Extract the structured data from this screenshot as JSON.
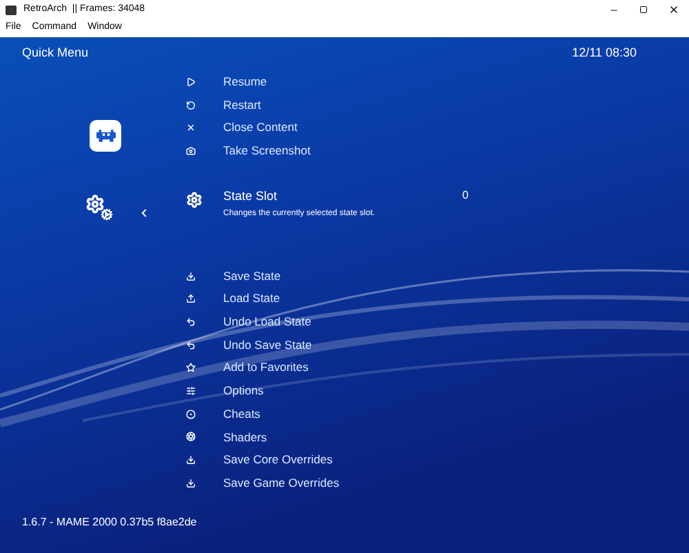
{
  "window": {
    "title": "RetroArch  || Frames: 34048"
  },
  "menu_bar": [
    "File",
    "Command",
    "Window"
  ],
  "header": {
    "title": "Quick Menu",
    "clock": "12/11 08:30"
  },
  "menu_items": [
    {
      "label": "Resume",
      "kind": "play",
      "selected": false
    },
    {
      "label": "Restart",
      "kind": "restart",
      "selected": false
    },
    {
      "label": "Close Content",
      "kind": "close",
      "selected": false
    },
    {
      "label": "Take Screenshot",
      "kind": "camera",
      "selected": false
    },
    {
      "label": "State Slot",
      "kind": "settings",
      "selected": true,
      "description": "Changes the currently selected state slot.",
      "value": "0"
    },
    {
      "label": "Save State",
      "kind": "save",
      "selected": false
    },
    {
      "label": "Load State",
      "kind": "load",
      "selected": false
    },
    {
      "label": "Undo Load State",
      "kind": "undo",
      "selected": false
    },
    {
      "label": "Undo Save State",
      "kind": "undo",
      "selected": false
    },
    {
      "label": "Add to Favorites",
      "kind": "favorite",
      "selected": false
    },
    {
      "label": "Options",
      "kind": "options",
      "selected": false
    },
    {
      "label": "Cheats",
      "kind": "cheats",
      "selected": false
    },
    {
      "label": "Shaders",
      "kind": "shaders",
      "selected": false
    },
    {
      "label": "Save Core Overrides",
      "kind": "save",
      "selected": false
    },
    {
      "label": "Save Game Overrides",
      "kind": "save",
      "selected": false
    }
  ],
  "footer": "1.6.7 - MAME 2000 0.37b5 f8ae2de"
}
